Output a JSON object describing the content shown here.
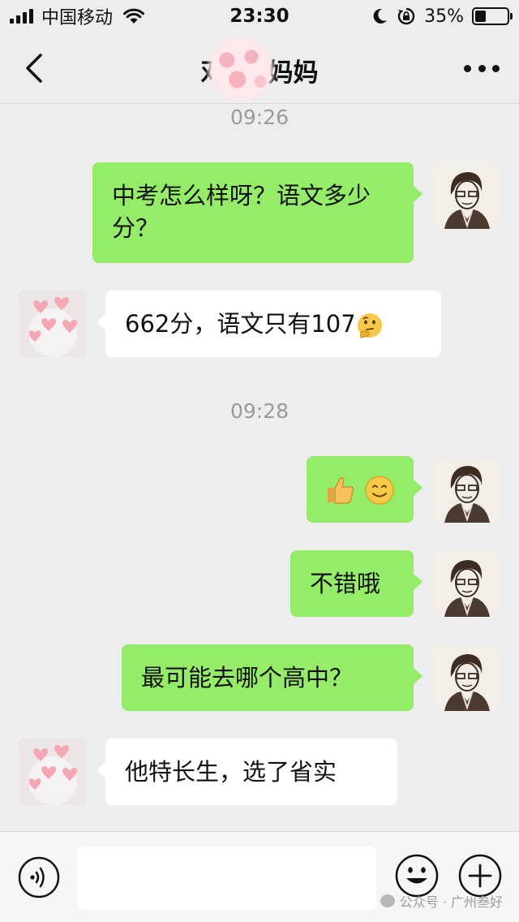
{
  "status_bar": {
    "carrier": "中国移动",
    "time": "23:30",
    "battery_percent_label": "35%",
    "battery_level": 0.35
  },
  "nav": {
    "title_visible_left": "邓",
    "title_visible_right": "妈妈",
    "back_icon": "chevron-left-icon",
    "more_icon": "more-horizontal-icon"
  },
  "messages": {
    "timestamp_1": "09:26",
    "msg_1": "中考怎么样呀？语文多少分？",
    "msg_2": "662分，语文只有107",
    "msg_2_emoji": "thinking-face-icon",
    "timestamp_2": "09:28",
    "msg_3_emojis": [
      "thumbs-up-icon",
      "smiling-face-icon"
    ],
    "msg_4": "不错哦",
    "msg_5": "最可能去哪个高中？",
    "msg_6": "他特长生，选了省实"
  },
  "input_bar": {
    "input_value": "",
    "watermark": "公众号 · 广州叁好"
  },
  "colors": {
    "background": "#ededed",
    "bubble_mine": "#95ec69",
    "bubble_theirs": "#ffffff",
    "timestamp": "#9a9a9a"
  }
}
